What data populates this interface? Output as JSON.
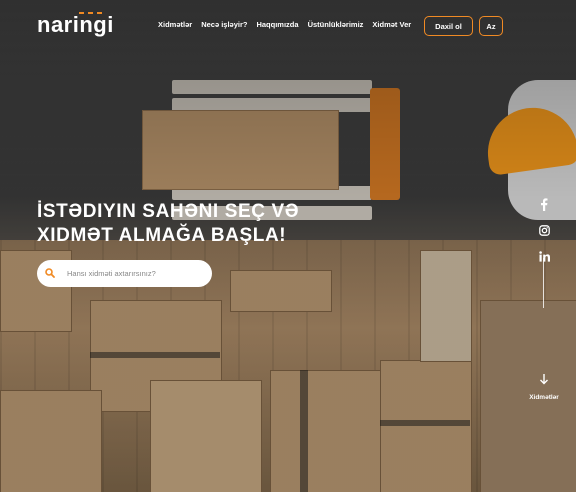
{
  "brand": {
    "name": "naringi",
    "accent_color": "#f08a24"
  },
  "nav": {
    "items": [
      {
        "label": "Xidmətlər"
      },
      {
        "label": "Necə işləyir?"
      },
      {
        "label": "Haqqımızda"
      },
      {
        "label": "Üstünlüklərimiz"
      },
      {
        "label": "Xidmət Ver"
      }
    ]
  },
  "header": {
    "login_label": "Daxil ol",
    "lang_label": "Az"
  },
  "hero": {
    "headline_line1": "İstədiyin sahəni seç və",
    "headline_line2": "xidmət almağa başla!",
    "search_placeholder": "Hansı xidməti axtarırsınız?"
  },
  "social": {
    "icons": [
      "facebook-icon",
      "instagram-icon",
      "linkedin-icon"
    ]
  },
  "scroll": {
    "label": "Xidmətlər",
    "icon": "arrow-down-icon"
  }
}
